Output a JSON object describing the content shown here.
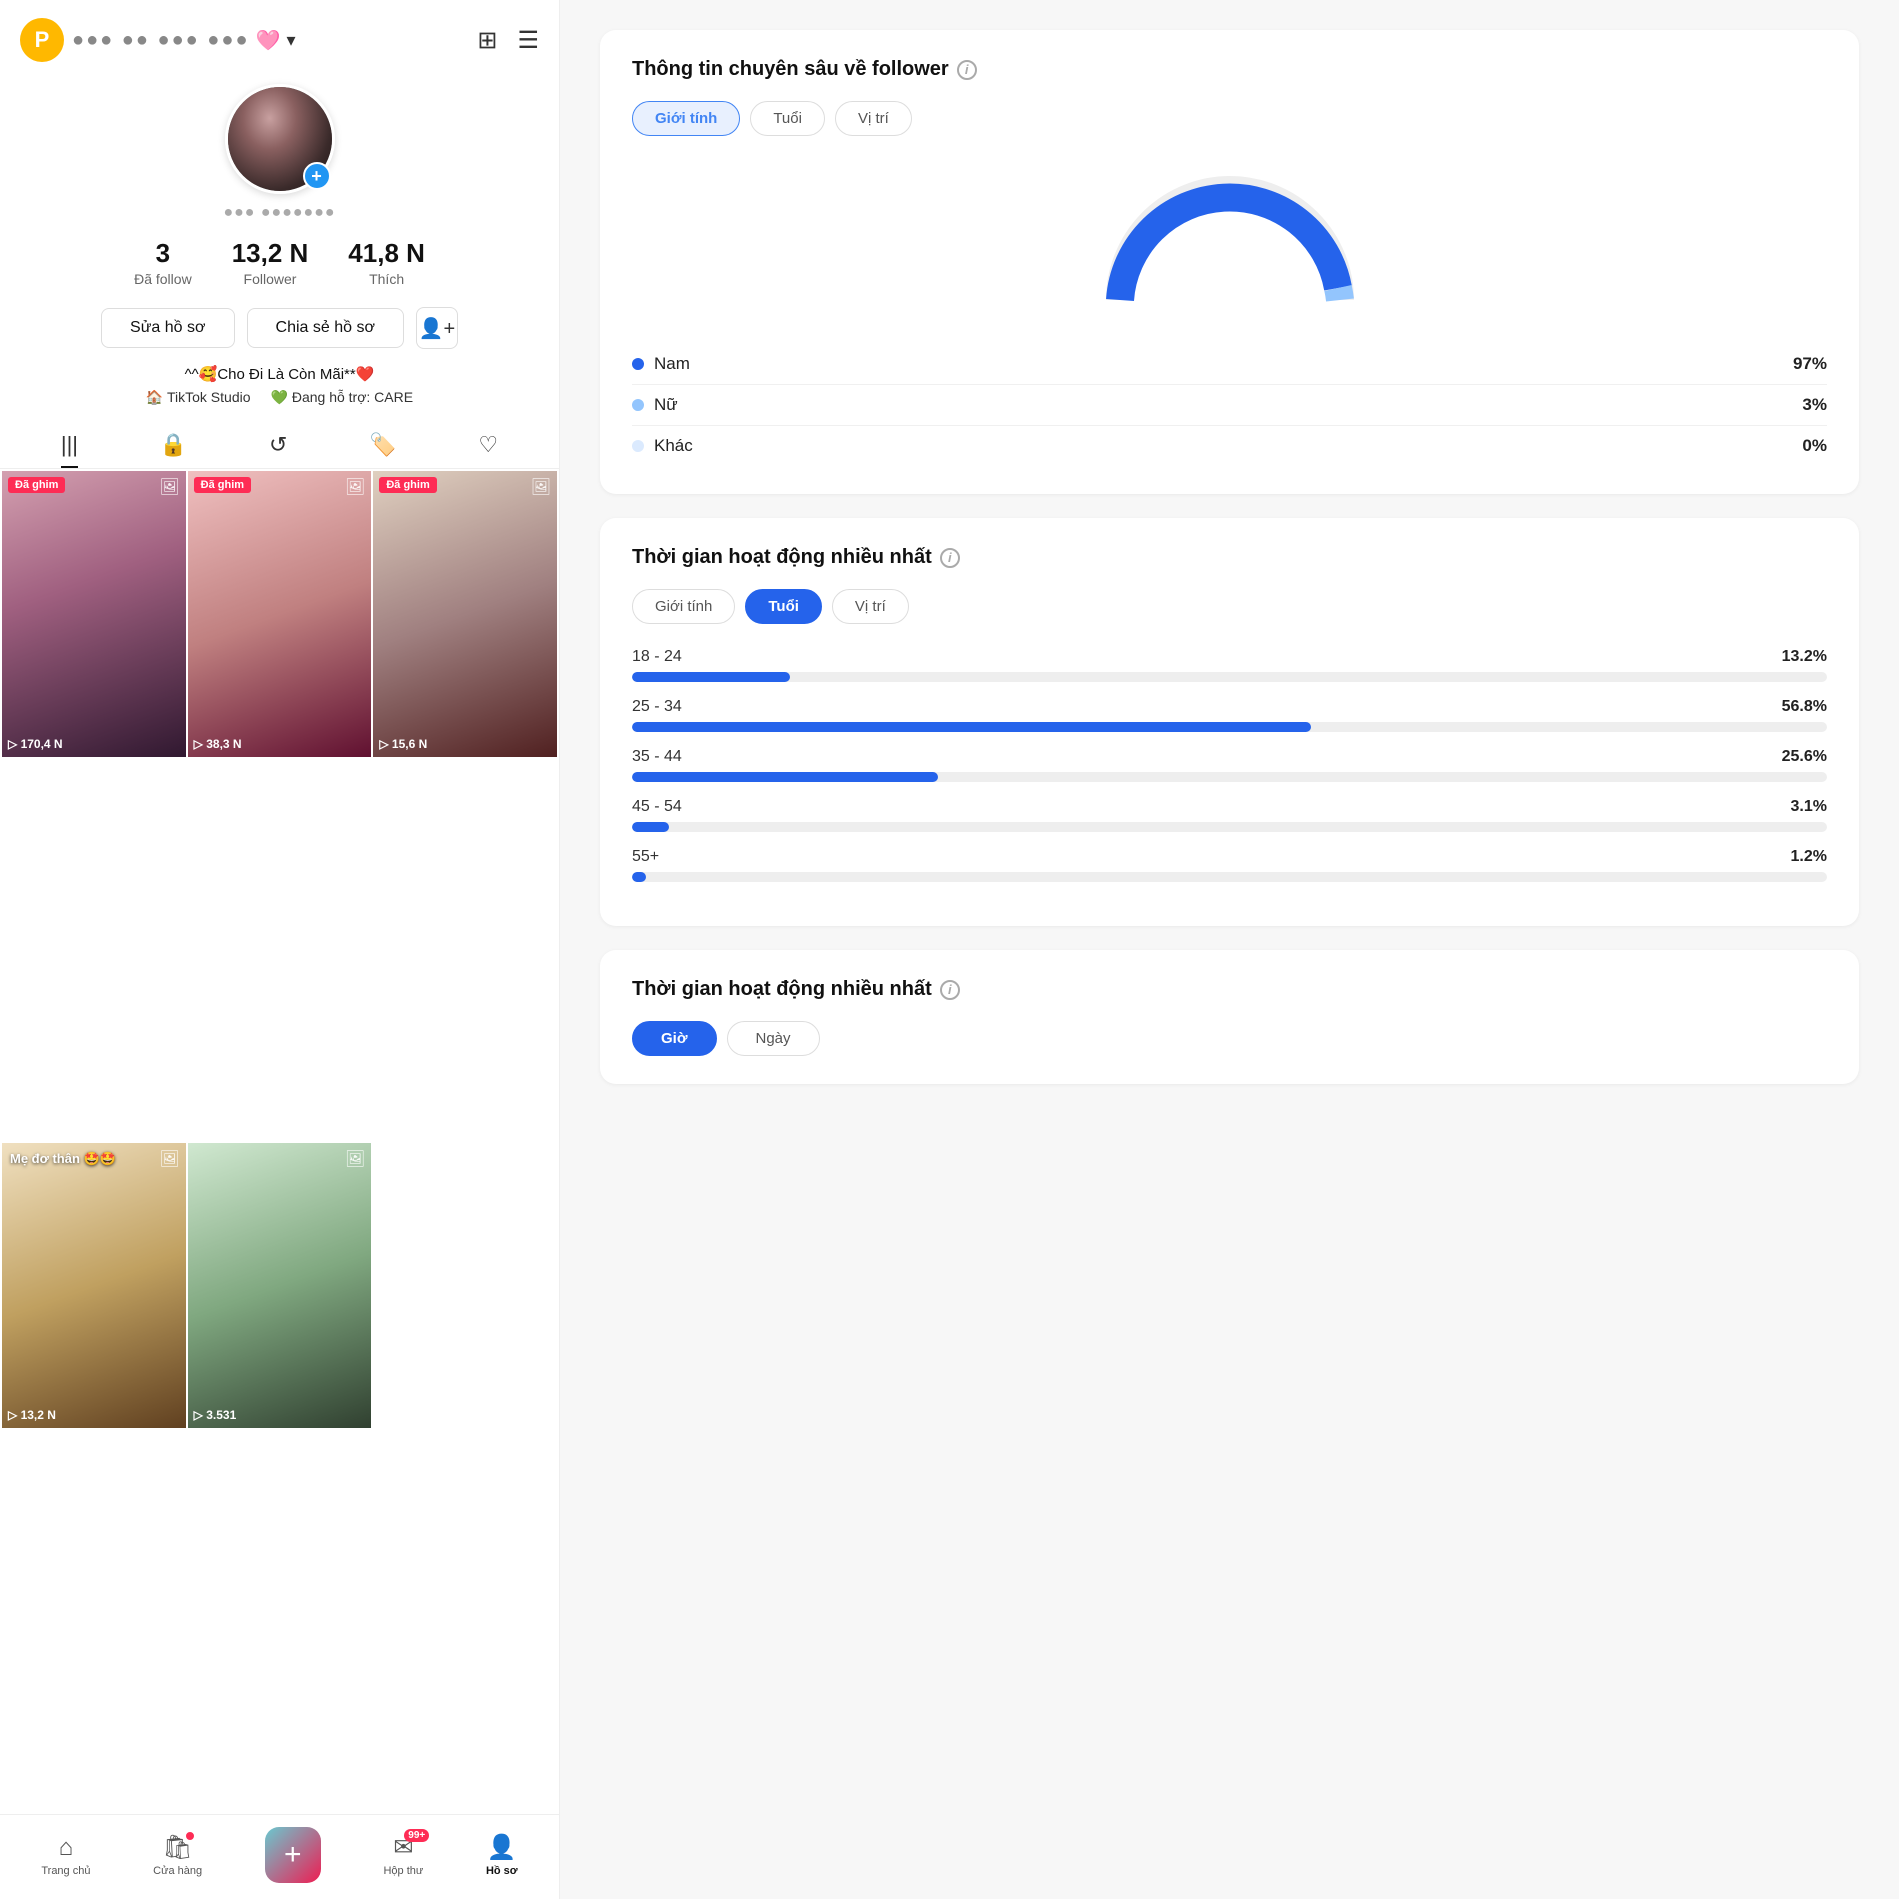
{
  "app": {
    "p_badge": "P",
    "username": "●●● ●● ●●● ●●●",
    "username_emoji": "🩷",
    "chevron": "▾"
  },
  "top_icons": {
    "calendar": "⊞",
    "menu": "☰"
  },
  "profile": {
    "plus_icon": "+",
    "handle": "●●● ●●●●●●●",
    "stats": [
      {
        "num": "3",
        "label": "Đã follow"
      },
      {
        "num": "13,2 N",
        "label": "Follower"
      },
      {
        "num": "41,8 N",
        "label": "Thích"
      }
    ],
    "btn_edit": "Sửa hồ sơ",
    "btn_share": "Chia sẻ hồ sơ",
    "btn_adduser": "👤+",
    "bio_line1": "^^🥰Cho Đi Là Còn Mãi**❤️",
    "bio_tiktok": "🏠 TikTok Studio",
    "bio_care": "💚 Đang hỗ trợ: CARE"
  },
  "tabs": [
    {
      "icon": "|||",
      "active": true
    },
    {
      "icon": "🔒",
      "active": false
    },
    {
      "icon": "↺",
      "active": false
    },
    {
      "icon": "🏷",
      "active": false
    },
    {
      "icon": "♡",
      "active": false
    }
  ],
  "videos": [
    {
      "bg": "video-bg-1",
      "pinned": "Đã ghim",
      "views": "▷ 170,4 N",
      "has_img": true
    },
    {
      "bg": "video-bg-2",
      "pinned": "Đã ghim",
      "views": "▷ 38,3 N",
      "has_img": true
    },
    {
      "bg": "video-bg-3",
      "pinned": "Đã ghim",
      "views": "▷ 15,6 N",
      "has_img": true
    },
    {
      "bg": "video-bg-4",
      "title": "Mẹ đơ thân 🤩🤩",
      "views": "▷ 13,2 N",
      "has_img": true
    },
    {
      "bg": "video-bg-5",
      "views": "▷ 3.531",
      "has_img": true
    }
  ],
  "bottom_nav": [
    {
      "icon": "⌂",
      "label": "Trang chủ",
      "active": false
    },
    {
      "icon": "🛍",
      "label": "Cửa hàng",
      "active": false,
      "badge": true
    },
    {
      "icon": "+",
      "label": "",
      "is_center": true
    },
    {
      "icon": "✉",
      "label": "Hộp thư",
      "active": false,
      "count": "99+"
    },
    {
      "icon": "👤",
      "label": "Hồ sơ",
      "active": true
    }
  ],
  "follower_card": {
    "title": "Thông tin chuyên sâu về follower",
    "info_icon": "i",
    "filter_tabs": [
      "Giới tính",
      "Tuổi",
      "Vị trí"
    ],
    "active_tab": "Giới tính",
    "genders": [
      {
        "name": "Nam",
        "pct": "97%",
        "color": "#2563EB",
        "bar": 97
      },
      {
        "name": "Nữ",
        "pct": "3%",
        "color": "#93C5FD",
        "bar": 3
      },
      {
        "name": "Khác",
        "pct": "0%",
        "color": "#DBEAFE",
        "bar": 0
      }
    ]
  },
  "activity_card1": {
    "title": "Thời gian hoạt động nhiều nhất",
    "info_icon": "i",
    "filter_tabs": [
      "Giới tính",
      "Tuổi",
      "Vị trí"
    ],
    "active_tab": "Tuổi",
    "age_groups": [
      {
        "label": "18 - 24",
        "pct": "13.2%",
        "bar": 13.2
      },
      {
        "label": "25 - 34",
        "pct": "56.8%",
        "bar": 56.8
      },
      {
        "label": "35 - 44",
        "pct": "25.6%",
        "bar": 25.6
      },
      {
        "label": "45 - 54",
        "pct": "3.1%",
        "bar": 3.1
      },
      {
        "label": "55+",
        "pct": "1.2%",
        "bar": 1.2
      }
    ]
  },
  "activity_card2": {
    "title": "Thời gian hoạt động nhiều nhất",
    "info_icon": "i",
    "time_tabs": [
      "Giờ",
      "Ngày"
    ],
    "active_tab": "Giờ"
  }
}
